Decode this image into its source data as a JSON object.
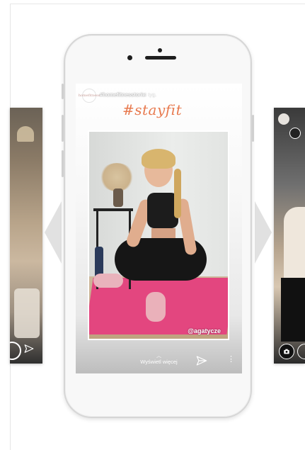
{
  "stories": {
    "center": {
      "username": "#homefitnesstorie",
      "time": "4 tyg.",
      "avatar_text": "homefitness",
      "sticker_text": "#stayfit",
      "photo_credit": "@agatycze",
      "see_more_label": "Wyświetl więcej"
    }
  },
  "icons": {
    "send": "send-icon",
    "more": "more-options-icon",
    "camera": "camera-icon",
    "chevron": "chevron-up-icon"
  },
  "colors": {
    "sticker": "#e87a4f",
    "mat": "#e3467f",
    "arrow": "#e1e1e1",
    "phone_frame": "#d6d6d6"
  }
}
